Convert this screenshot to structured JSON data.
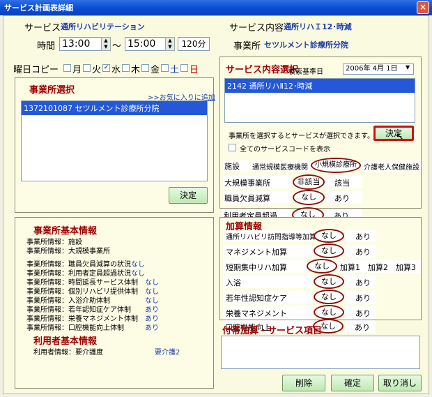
{
  "window": {
    "title": "サービス計画表詳細",
    "close_label": "×"
  },
  "service": {
    "label": "サービス",
    "value": "通所リハビリテーション",
    "content_label": "サービス内容",
    "content_value": "通所リハＩ12･時減",
    "office_label": "事業所",
    "office_value": "セツルメント診療所分院"
  },
  "time": {
    "label": "時間",
    "start": "13:00",
    "separator": "～",
    "end": "15:00",
    "duration": "120分"
  },
  "weekday_copy": {
    "label": "曜日コピー",
    "days": [
      {
        "label": "月",
        "checked": ""
      },
      {
        "label": "火",
        "checked": ""
      },
      {
        "label": "水",
        "checked": "✓"
      },
      {
        "label": "木",
        "checked": ""
      },
      {
        "label": "金",
        "checked": ""
      },
      {
        "label": "土",
        "checked": ""
      },
      {
        "label": "日",
        "checked": ""
      }
    ]
  },
  "office_select": {
    "title": "事業所選択",
    "favorite_link": ">>お気に入りに追加",
    "items": [
      "1372101087 セツルメント診療所分院"
    ],
    "decide_label": "決定"
  },
  "service_select": {
    "title": "サービス内容選択",
    "date_label": "検索基準日",
    "date_value": "2006年 4月 1日",
    "items": [
      "2142 通所リハⅡ12･時減"
    ],
    "hint": "事業所を選択するとサービスが選択できます。",
    "decide_label": "決定",
    "show_all_label": "全てのサービスコードを表示",
    "facility_label": "施設",
    "facility_options": [
      "通常規模医療機関",
      "小規模診療所",
      "介護老人保健施設"
    ],
    "rows": [
      {
        "label": "大規模事業所",
        "opt1": "非該当",
        "opt2": "該当"
      },
      {
        "label": "職員欠員減算",
        "opt1": "なし",
        "opt2": "あり"
      },
      {
        "label": "利用者定員超過",
        "opt1": "なし",
        "opt2": "あり"
      }
    ]
  },
  "office_info": {
    "title": "事業所基本情報",
    "rows": [
      {
        "label": "事業所情報：施設",
        "value": ""
      },
      {
        "label": "事業所情報：大規模事業所",
        "value": ""
      },
      {
        "label": "事業所情報：職員欠員減算の状況",
        "value": "なし"
      },
      {
        "label": "事業所情報：利用者定員超過状況",
        "value": "なし"
      },
      {
        "label": "事業所情報：時間延長サービス体制",
        "value": "なし"
      },
      {
        "label": "事業所情報：個別リハビリ提供体制",
        "value": "なし"
      },
      {
        "label": "事業所情報：入浴介助体制",
        "value": "なし"
      },
      {
        "label": "事業所情報：若年認知症ケア体制",
        "value": "あり"
      },
      {
        "label": "事業所情報：栄養マネジメント体制",
        "value": "あり"
      },
      {
        "label": "事業所情報：口腔機能向上体制",
        "value": "あり"
      }
    ],
    "user_title": "利用者基本情報",
    "user_label": "利用者情報：要介護度",
    "user_value": "要介護2"
  },
  "addition": {
    "title": "加算情報",
    "rows": [
      {
        "label": "通所リハビリ訪問指導等加算",
        "opt1": "なし",
        "opt2": "あり"
      },
      {
        "label": "マネジメント加算",
        "opt1": "なし",
        "opt2": "あり"
      },
      {
        "label": "短期集中リハ加算",
        "opt1": "なし",
        "opt2": "加算1",
        "opt3": "加算2",
        "opt4": "加算3"
      },
      {
        "label": "入浴",
        "opt1": "なし",
        "opt2": "あり"
      },
      {
        "label": "若年性認知症ケア",
        "opt1": "なし",
        "opt2": "あり"
      },
      {
        "label": "栄養マネジメント",
        "opt1": "なし",
        "opt2": "あり"
      },
      {
        "label": "口腔機能向上",
        "opt1": "なし",
        "opt2": "あり"
      }
    ]
  },
  "extra": {
    "title": "付帯加算・サービス項目"
  },
  "footer": {
    "delete_label": "削除",
    "confirm_label": "確定",
    "cancel_label": "取り消し"
  }
}
